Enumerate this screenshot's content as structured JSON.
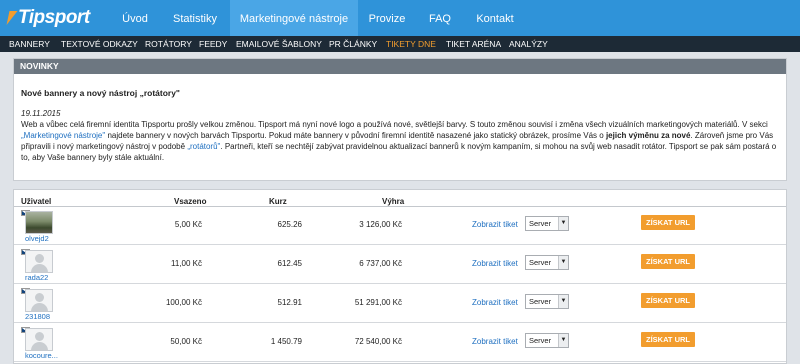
{
  "brand": {
    "logo_text": "Tipsport",
    "accent": "#2f93d9",
    "orange": "#f29d2e"
  },
  "topnav": {
    "items": [
      "Úvod",
      "Statistiky",
      "Marketingové nástroje",
      "Provize",
      "FAQ",
      "Kontakt"
    ],
    "active": "Marketingové nástroje"
  },
  "subnav": {
    "items": [
      "BANNERY",
      "TEXTOVÉ ODKAZY",
      "ROTÁTORY",
      "FEEDY",
      "EMAILOVÉ ŠABLONY",
      "PR ČLÁNKY",
      "TIKETY DNE",
      "TIKET ARÉNA",
      "ANALÝZY"
    ],
    "active": "TIKETY DNE"
  },
  "news": {
    "header": "NOVINKY",
    "title": "Nové bannery a nový nástroj „rotátory\"",
    "date": "19.11.2015",
    "p1": "Web a vůbec celá firemní identita Tipsportu prošly velkou změnou. Tipsport má nyní nové logo a používá nové, světlejší barvy. S touto změnou souvisí i změna všech vizuálních marketingových materiálů. V sekci ",
    "link1": "„Marketingové nástroje\"",
    "p2": " najdete bannery v nových barvách Tipsportu. Pokud máte bannery v původní firemní identitě nasazené jako statický obrázek, prosíme Vás o ",
    "bold": "jejich výměnu za nové",
    "p3": ". Zároveň jsme pro Vás připravili i nový marketingový nástroj v podobě ",
    "link2": "„rotátorů\"",
    "p4": ". Partneři, kteří se nechtějí zabývat pravidelnou aktualizací bannerů k novým kampaním, si mohou na svůj web nasadit rotátor. Tipsport se pak sám postará o to, aby Vaše bannery byly stále aktuální."
  },
  "table": {
    "headers": {
      "user": "Uživatel",
      "stake": "Vsazeno",
      "odds": "Kurz",
      "win": "Výhra"
    },
    "view_label": "Zobrazit tiket",
    "select_value": "Server",
    "button_label": "ZÍSKAT URL",
    "rows": [
      {
        "user": "olvejd2",
        "stake": "5,00 Kč",
        "odds": "625.26",
        "win": "3 126,00 Kč",
        "photo": true
      },
      {
        "user": "rada22",
        "stake": "11,00 Kč",
        "odds": "612.45",
        "win": "6 737,00 Kč",
        "photo": false
      },
      {
        "user": "231808",
        "stake": "100,00 Kč",
        "odds": "512.91",
        "win": "51 291,00 Kč",
        "photo": false
      },
      {
        "user": "kocoure...",
        "stake": "50,00 Kč",
        "odds": "1 450.79",
        "win": "72 540,00 Kč",
        "photo": false
      }
    ]
  }
}
